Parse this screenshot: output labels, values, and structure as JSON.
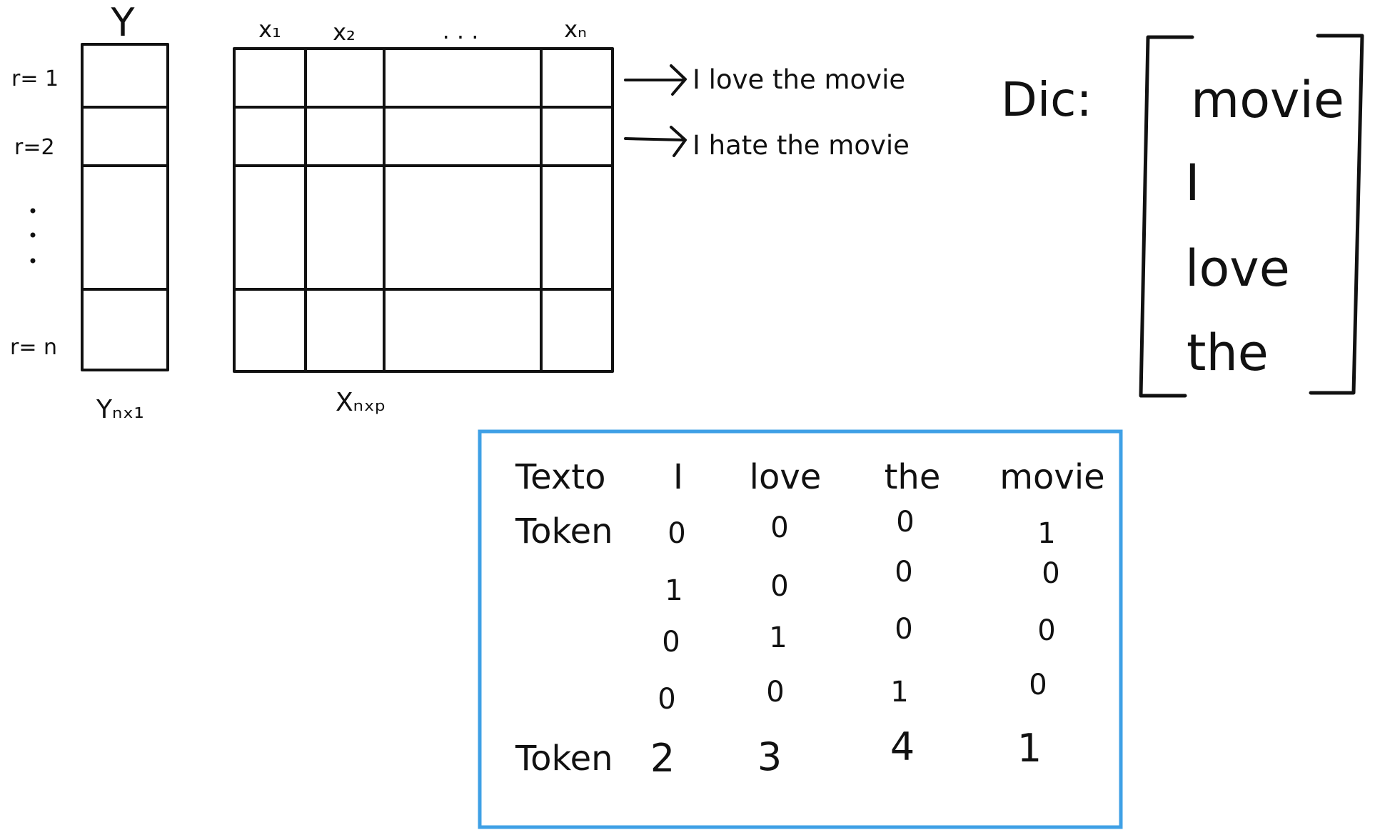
{
  "colors": {
    "ink": "#111111",
    "accent": "#3fa0e6",
    "background": "#ffffff"
  },
  "y_matrix": {
    "header": "Y",
    "row_labels": [
      "r= 1",
      "r=2",
      "r= n"
    ],
    "ellipsis": "⋮",
    "caption": "Yₙₓ₁"
  },
  "x_matrix": {
    "column_labels": [
      "x₁",
      "x₂",
      ". . .",
      "xₙ"
    ],
    "caption": "Xₙₓₚ"
  },
  "sentences": [
    "I love the movie",
    "I hate the movie"
  ],
  "dictionary": {
    "label": "Dic:",
    "words": [
      "movie",
      "I",
      "love",
      "the"
    ]
  },
  "table": {
    "header_label": "Texto",
    "columns": [
      "I",
      "love",
      "the",
      "movie"
    ],
    "token_label": "Token",
    "rows": [
      [
        "0",
        "0",
        "0",
        "1"
      ],
      [
        "1",
        "0",
        "0",
        "0"
      ],
      [
        "0",
        "1",
        "0",
        "0"
      ],
      [
        "0",
        "0",
        "1",
        "0"
      ]
    ],
    "final_label": "Token",
    "final_values": [
      "2",
      "3",
      "4",
      "1"
    ]
  }
}
